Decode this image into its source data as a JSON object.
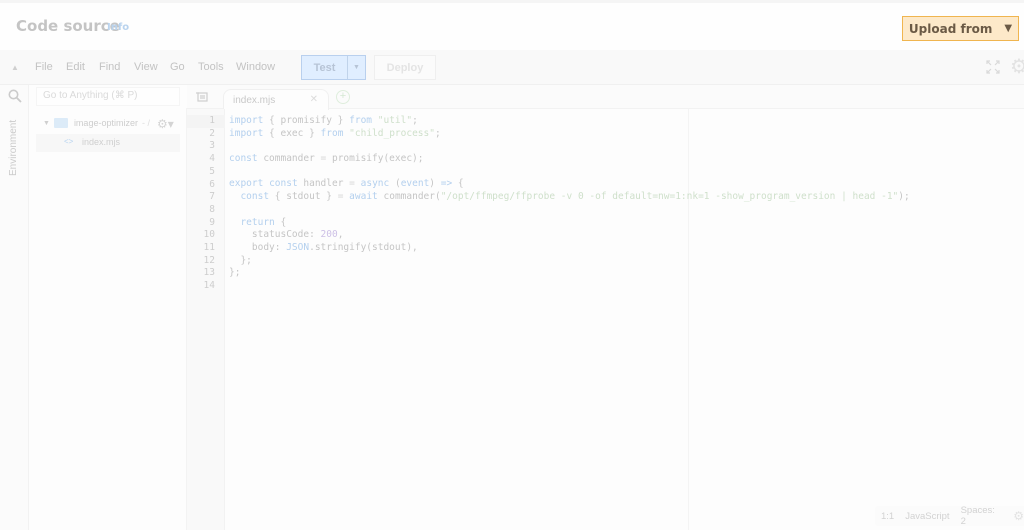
{
  "header": {
    "title": "Code source",
    "info_link": "Info",
    "upload_button": "Upload from",
    "upload_icon": "caret-down-icon"
  },
  "menubar": {
    "items": [
      "File",
      "Edit",
      "Find",
      "View",
      "Go",
      "Tools",
      "Window"
    ],
    "test_button": "Test",
    "deploy_button": "Deploy"
  },
  "sidebar": {
    "search_placeholder": "Go to Anything (⌘ P)",
    "rail_label": "Environment",
    "tree": {
      "root_folder": "image-optimizer",
      "root_path_suffix": "- /",
      "files": [
        "index.mjs"
      ]
    }
  },
  "editor": {
    "tabs": [
      {
        "label": "index.mjs",
        "active": true
      }
    ],
    "line_numbers": [
      "1",
      "2",
      "3",
      "4",
      "5",
      "6",
      "7",
      "8",
      "9",
      "10",
      "11",
      "12",
      "13",
      "14"
    ],
    "active_line": 1,
    "code_lines": [
      [
        {
          "t": "kw",
          "v": "import"
        },
        {
          "t": "p",
          "v": " { promisify } "
        },
        {
          "t": "kw",
          "v": "from"
        },
        {
          "t": "p",
          "v": " "
        },
        {
          "t": "str",
          "v": "\"util\""
        },
        {
          "t": "p",
          "v": ";"
        }
      ],
      [
        {
          "t": "kw",
          "v": "import"
        },
        {
          "t": "p",
          "v": " { exec } "
        },
        {
          "t": "kw",
          "v": "from"
        },
        {
          "t": "p",
          "v": " "
        },
        {
          "t": "str",
          "v": "\"child_process\""
        },
        {
          "t": "p",
          "v": ";"
        }
      ],
      [],
      [
        {
          "t": "kw",
          "v": "const"
        },
        {
          "t": "p",
          "v": " commander "
        },
        {
          "t": "op",
          "v": "="
        },
        {
          "t": "p",
          "v": " promisify(exec);"
        }
      ],
      [],
      [
        {
          "t": "kw",
          "v": "export"
        },
        {
          "t": "p",
          "v": " "
        },
        {
          "t": "kw",
          "v": "const"
        },
        {
          "t": "p",
          "v": " handler "
        },
        {
          "t": "op",
          "v": "="
        },
        {
          "t": "p",
          "v": " "
        },
        {
          "t": "kw",
          "v": "async"
        },
        {
          "t": "p",
          "v": " ("
        },
        {
          "t": "kw",
          "v": "event"
        },
        {
          "t": "p",
          "v": ") "
        },
        {
          "t": "kw",
          "v": "=>"
        },
        {
          "t": "p",
          "v": " {"
        }
      ],
      [
        {
          "t": "p",
          "v": "  "
        },
        {
          "t": "kw",
          "v": "const"
        },
        {
          "t": "p",
          "v": " { stdout } "
        },
        {
          "t": "op",
          "v": "="
        },
        {
          "t": "p",
          "v": " "
        },
        {
          "t": "kw",
          "v": "await"
        },
        {
          "t": "p",
          "v": " commander("
        },
        {
          "t": "str",
          "v": "\"/opt/ffmpeg/ffprobe -v 0 -of default=nw=1:nk=1 -show_program_version | head -1\""
        },
        {
          "t": "p",
          "v": ");"
        }
      ],
      [],
      [
        {
          "t": "p",
          "v": "  "
        },
        {
          "t": "kw",
          "v": "return"
        },
        {
          "t": "p",
          "v": " {"
        }
      ],
      [
        {
          "t": "p",
          "v": "    statusCode: "
        },
        {
          "t": "num",
          "v": "200"
        },
        {
          "t": "p",
          "v": ","
        }
      ],
      [
        {
          "t": "p",
          "v": "    body: "
        },
        {
          "t": "kw",
          "v": "JSON"
        },
        {
          "t": "p",
          "v": ".stringify(stdout),"
        }
      ],
      [
        {
          "t": "p",
          "v": "  };"
        }
      ],
      [
        {
          "t": "p",
          "v": "};"
        }
      ],
      []
    ]
  },
  "statusbar": {
    "cursor": "1:1",
    "language": "JavaScript",
    "indent": "Spaces: 2"
  }
}
